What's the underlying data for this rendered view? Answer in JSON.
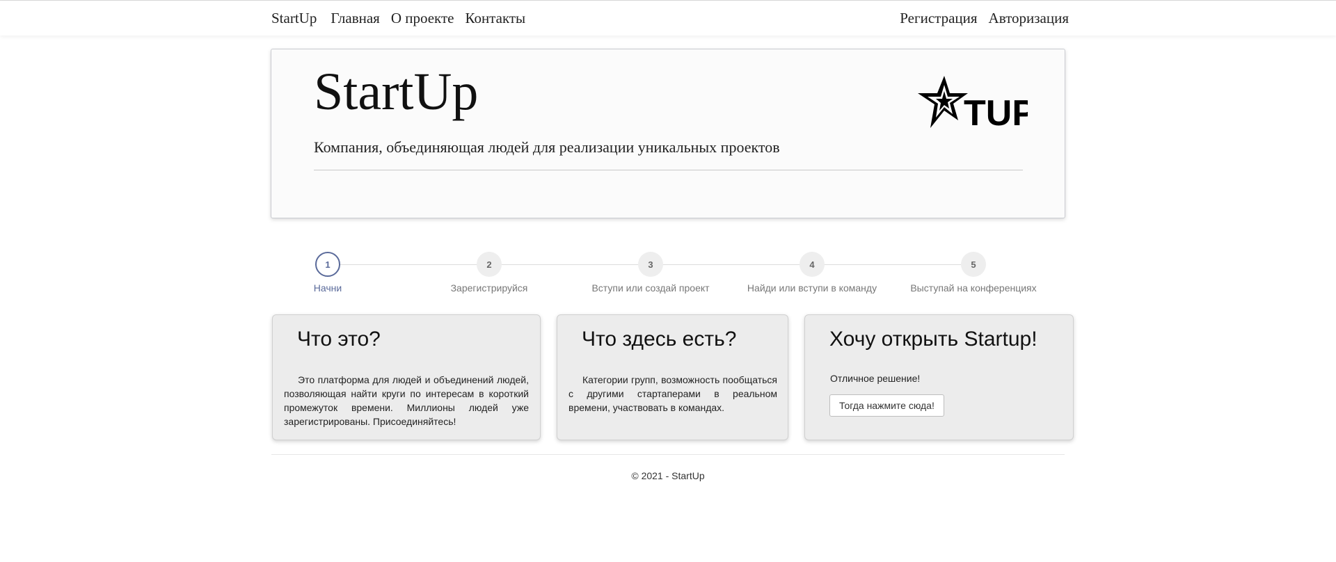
{
  "navbar": {
    "brand": "StartUp",
    "left_links": [
      "Главная",
      "О проекте",
      "Контакты"
    ],
    "right_links": [
      "Регистрация",
      "Авторизация"
    ]
  },
  "hero": {
    "title": "StartUp",
    "subtitle": "Компания, объединяющая людей для реализации уникальных проектов",
    "logo_icon": "startup-star-logo",
    "logo_text": "TUP"
  },
  "steps": [
    {
      "number": "1",
      "label": "Начни",
      "active": true
    },
    {
      "number": "2",
      "label": "Зарегистрируйся",
      "active": false
    },
    {
      "number": "3",
      "label": "Вступи или создай проект",
      "active": false
    },
    {
      "number": "4",
      "label": "Найди или вступи в команду",
      "active": false
    },
    {
      "number": "5",
      "label": "Выступай на конференциях",
      "active": false
    }
  ],
  "cards": [
    {
      "title": "Что это?",
      "text": "Это платформа для людей и объединений людей, позволяющая найти круги по интересам в короткий промежуток времени. Миллионы людей уже зарегистрированы. Присоединяйтесь!"
    },
    {
      "title": "Что здесь есть?",
      "text": "Категории групп, возможность пообщаться с другими стартаперами в реальном времени, участвовать в командах."
    },
    {
      "title": "Хочу открыть Startup!",
      "text": "Отличное решение!",
      "button_label": "Тогда нажмите сюда!"
    }
  ],
  "footer": {
    "text": "© 2021 - StartUp"
  },
  "colors": {
    "accent": "#5a6a9a",
    "card_bg": "#ececec",
    "hero_bg": "#fbfbfb"
  }
}
